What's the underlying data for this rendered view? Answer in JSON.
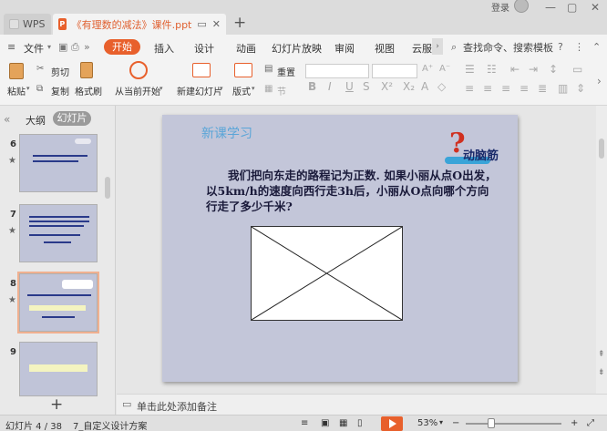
{
  "titlebar": {
    "app_tab": "WPS",
    "doc_tab": "《有理数的减法》课件.ppt",
    "new_tab": "+",
    "login": "登录"
  },
  "menu": {
    "file": "文件",
    "start": "开始",
    "insert": "插入",
    "design": "设计",
    "animation": "动画",
    "slideshow": "幻灯片放映",
    "review": "审阅",
    "view": "视图",
    "cloud": "云服务",
    "search": "查找命令、搜索模板",
    "help": "?"
  },
  "ribbon": {
    "paste": "粘贴",
    "cut": "剪切",
    "copy": "复制",
    "format_painter": "格式刷",
    "from_current": "从当前开始",
    "new_slide": "新建幻灯片",
    "layout": "版式",
    "reset": "重置",
    "section": "节"
  },
  "sidebar": {
    "outline_tab": "大纲",
    "slides_tab": "幻灯片",
    "thumbs": [
      {
        "num": "6"
      },
      {
        "num": "7"
      },
      {
        "num": "8"
      },
      {
        "num": "9"
      }
    ],
    "add": "+"
  },
  "slide": {
    "header": "新课学习",
    "badge": "动脑筋",
    "question_mark": "?",
    "body": "我们把向东走的路程记为正数. 如果小丽从点O出发，以5km/h的速度向西行走3h后，小丽从O点向哪个方向行走了多少千米?"
  },
  "notes": {
    "placeholder": "单击此处添加备注"
  },
  "statusbar": {
    "slide_counter": "幻灯片 4 / 38",
    "theme": "7_自定义设计方案",
    "zoom": "53%",
    "zoom_minus": "−",
    "zoom_plus": "+"
  },
  "colors": {
    "accent": "#e8602c",
    "slide_bg": "#c3c6d9",
    "header_blue": "#5aa5d8"
  }
}
